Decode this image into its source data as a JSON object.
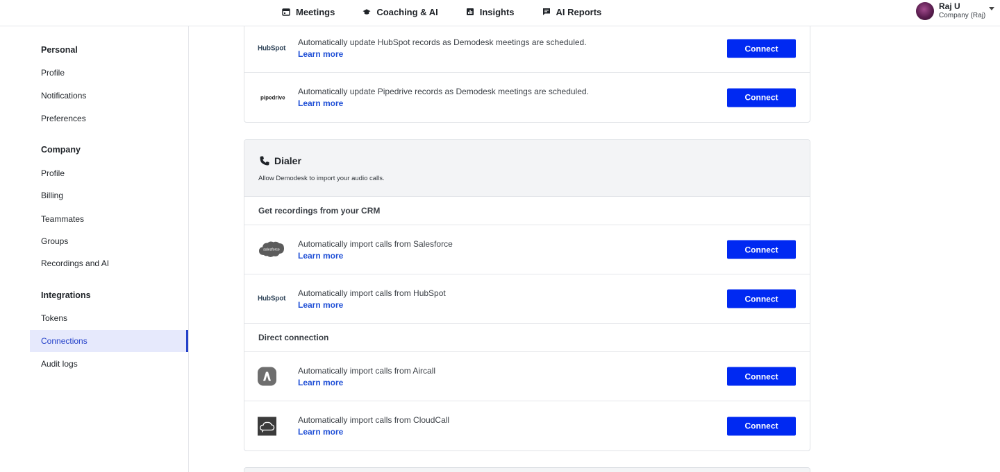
{
  "nav": {
    "items": [
      {
        "label": "Meetings",
        "icon": "calendar-icon"
      },
      {
        "label": "Coaching & AI",
        "icon": "graduation-cap-icon"
      },
      {
        "label": "Insights",
        "icon": "chart-icon"
      },
      {
        "label": "AI Reports",
        "icon": "chat-report-icon"
      }
    ]
  },
  "user": {
    "name": "Raj U",
    "company": "Company (Raj)"
  },
  "sidebar": {
    "personal_heading": "Personal",
    "personal_items": [
      "Profile",
      "Notifications",
      "Preferences"
    ],
    "company_heading": "Company",
    "company_items": [
      "Profile",
      "Billing",
      "Teammates",
      "Groups",
      "Recordings and AI"
    ],
    "integrations_heading": "Integrations",
    "integrations_items": [
      "Tokens",
      "Connections",
      "Audit logs"
    ],
    "active_item": "Connections"
  },
  "crm_card": {
    "rows": [
      {
        "logo": "HubSpot",
        "description": "Automatically update HubSpot records as Demodesk meetings are scheduled.",
        "learn_more": "Learn more",
        "button": "Connect"
      },
      {
        "logo": "pipedrive",
        "description": "Automatically update Pipedrive records as Demodesk meetings are scheduled.",
        "learn_more": "Learn more",
        "button": "Connect"
      }
    ]
  },
  "dialer": {
    "title": "Dialer",
    "subtitle": "Allow Demodesk to import your audio calls.",
    "section_crm": "Get recordings from your CRM",
    "crm_rows": [
      {
        "logo": "salesforce",
        "description": "Automatically import calls from Salesforce",
        "learn_more": "Learn more",
        "button": "Connect"
      },
      {
        "logo": "HubSpot",
        "description": "Automatically import calls from HubSpot",
        "learn_more": "Learn more",
        "button": "Connect"
      }
    ],
    "section_direct": "Direct connection",
    "direct_rows": [
      {
        "logo": "aircall-icon",
        "description": "Automatically import calls from Aircall",
        "learn_more": "Learn more",
        "button": "Connect"
      },
      {
        "logo": "cloudcall-icon",
        "description": "Automatically import calls from CloudCall",
        "learn_more": "Learn more",
        "button": "Connect"
      }
    ]
  },
  "colors": {
    "accent": "#0029f2",
    "link": "#1f4fd6",
    "active_bg": "#e6e9fc",
    "active_text": "#2340c9"
  }
}
